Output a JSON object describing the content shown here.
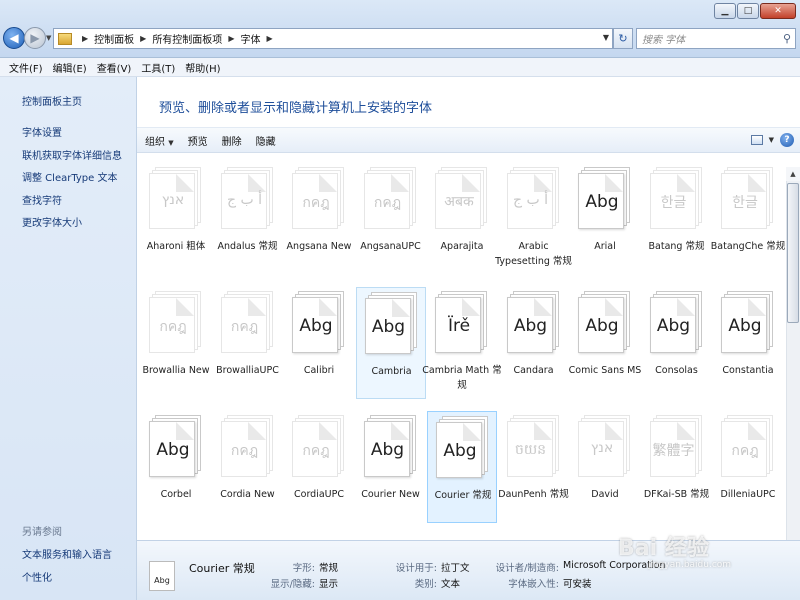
{
  "window": {
    "minimize": "▁",
    "maximize": "□",
    "close": "✕"
  },
  "address": {
    "crumbs": [
      "控制面板",
      "所有控制面板项",
      "字体"
    ],
    "search_placeholder": "搜索 字体"
  },
  "menu": [
    "文件(F)",
    "编辑(E)",
    "查看(V)",
    "工具(T)",
    "帮助(H)"
  ],
  "sidebar": {
    "home": "控制面板主页",
    "links": [
      "字体设置",
      "联机获取字体详细信息",
      "调整 ClearType 文本",
      "查找字符",
      "更改字体大小"
    ],
    "see_also_heading": "另请参阅",
    "see_also": [
      "文本服务和输入语言",
      "个性化"
    ]
  },
  "content": {
    "title": "预览、删除或者显示和隐藏计算机上安装的字体",
    "toolbar": [
      "组织",
      "预览",
      "删除",
      "隐藏"
    ]
  },
  "fonts": [
    {
      "name": "Aharoni 粗体",
      "sample": "אנץ",
      "dim": true
    },
    {
      "name": "Andalus 常规",
      "sample": "أ ب ج",
      "dim": true
    },
    {
      "name": "Angsana New",
      "sample": "กคฎ",
      "dim": true
    },
    {
      "name": "AngsanaUPC",
      "sample": "กคฎ",
      "dim": true
    },
    {
      "name": "Aparajita",
      "sample": "अबक",
      "dim": true
    },
    {
      "name": "Arabic Typesetting 常规",
      "sample": "أ ب ج",
      "dim": true
    },
    {
      "name": "Arial",
      "sample": "Abg",
      "dim": false
    },
    {
      "name": "Batang 常规",
      "sample": "한글",
      "dim": true
    },
    {
      "name": "BatangChe 常规",
      "sample": "한글",
      "dim": true
    },
    {
      "name": "Browallia New",
      "sample": "กคฎ",
      "dim": true
    },
    {
      "name": "BrowalliaUPC",
      "sample": "กคฎ",
      "dim": true
    },
    {
      "name": "Calibri",
      "sample": "Abg",
      "dim": false
    },
    {
      "name": "Cambria",
      "sample": "Abg",
      "dim": false
    },
    {
      "name": "Cambria Math 常规",
      "sample": "Ïrě",
      "dim": false
    },
    {
      "name": "Candara",
      "sample": "Abg",
      "dim": false
    },
    {
      "name": "Comic Sans MS",
      "sample": "Abg",
      "dim": false
    },
    {
      "name": "Consolas",
      "sample": "Abg",
      "dim": false
    },
    {
      "name": "Constantia",
      "sample": "Abg",
      "dim": false
    },
    {
      "name": "Corbel",
      "sample": "Abg",
      "dim": false
    },
    {
      "name": "Cordia New",
      "sample": "กคฎ",
      "dim": true
    },
    {
      "name": "CordiaUPC",
      "sample": "กคฎ",
      "dim": true
    },
    {
      "name": "Courier New",
      "sample": "Abg",
      "dim": false
    },
    {
      "name": "Courier 常规",
      "sample": "Abg",
      "dim": false
    },
    {
      "name": "DaunPenh 常规",
      "sample": "ចយន",
      "dim": true
    },
    {
      "name": "David",
      "sample": "אנץ",
      "dim": true
    },
    {
      "name": "DFKai-SB 常规",
      "sample": "繁體字",
      "dim": true
    },
    {
      "name": "DilleniaUPC",
      "sample": "กคฎ",
      "dim": true
    }
  ],
  "details": {
    "icon_text": "Abg",
    "name": "Courier 常规",
    "style_label": "字形:",
    "style_value": "常规",
    "visibility_label": "显示/隐藏:",
    "visibility_value": "显示",
    "designed_for_label": "设计用于:",
    "designed_for_value": "拉丁文",
    "category_label": "类别:",
    "category_value": "文本",
    "designer_label": "设计者/制造商:",
    "designer_value": "Microsoft Corporation",
    "embed_label": "字体嵌入性:",
    "embed_value": "可安装"
  },
  "watermark": {
    "text": "Bai 经验",
    "sub": "jingyan.baidu.com"
  }
}
